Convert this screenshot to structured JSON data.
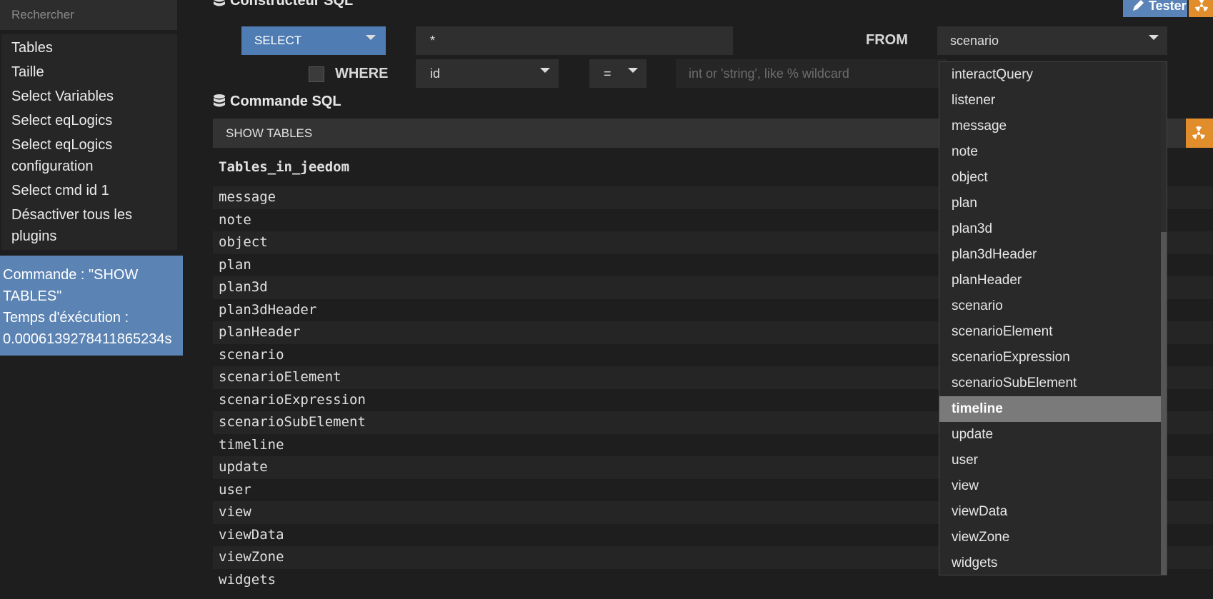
{
  "sidebar": {
    "search_placeholder": "Rechercher",
    "items": [
      {
        "label": "Tables"
      },
      {
        "label": "Taille"
      },
      {
        "label": "Select Variables"
      },
      {
        "label": "Select eqLogics"
      },
      {
        "label": "Select eqLogics configuration"
      },
      {
        "label": "Select cmd id 1"
      },
      {
        "label": "Désactiver tous les plugins"
      }
    ],
    "result_info": {
      "line1": "Commande : \"SHOW",
      "line2": "TABLES\"",
      "line3": "Temps d'éxécution :",
      "line4": "0.0006139278411865234s"
    }
  },
  "builder": {
    "title": "Constructeur SQL",
    "tester_label": "Tester",
    "select_label": "SELECT",
    "columns_value": "*",
    "from_label": "FROM",
    "from_value": "scenario",
    "where_label": "WHERE",
    "where_field": "id",
    "where_operator": "=",
    "where_placeholder": "int or 'string', like % wildcard"
  },
  "command": {
    "title": "Commande SQL",
    "value": "SHOW TABLES"
  },
  "results": {
    "column": "Tables_in_jeedom",
    "rows": [
      "message",
      "note",
      "object",
      "plan",
      "plan3d",
      "plan3dHeader",
      "planHeader",
      "scenario",
      "scenarioElement",
      "scenarioExpression",
      "scenarioSubElement",
      "timeline",
      "update",
      "user",
      "view",
      "viewData",
      "viewZone",
      "widgets"
    ]
  },
  "from_dropdown": {
    "options": [
      "interactQuery",
      "listener",
      "message",
      "note",
      "object",
      "plan",
      "plan3d",
      "plan3dHeader",
      "planHeader",
      "scenario",
      "scenarioElement",
      "scenarioExpression",
      "scenarioSubElement",
      "timeline",
      "update",
      "user",
      "view",
      "viewData",
      "viewZone",
      "widgets"
    ],
    "highlighted": "timeline"
  },
  "colors": {
    "accent_blue": "#4f7db3",
    "accent_orange": "#e18d2c",
    "background": "#1e1e1e"
  }
}
